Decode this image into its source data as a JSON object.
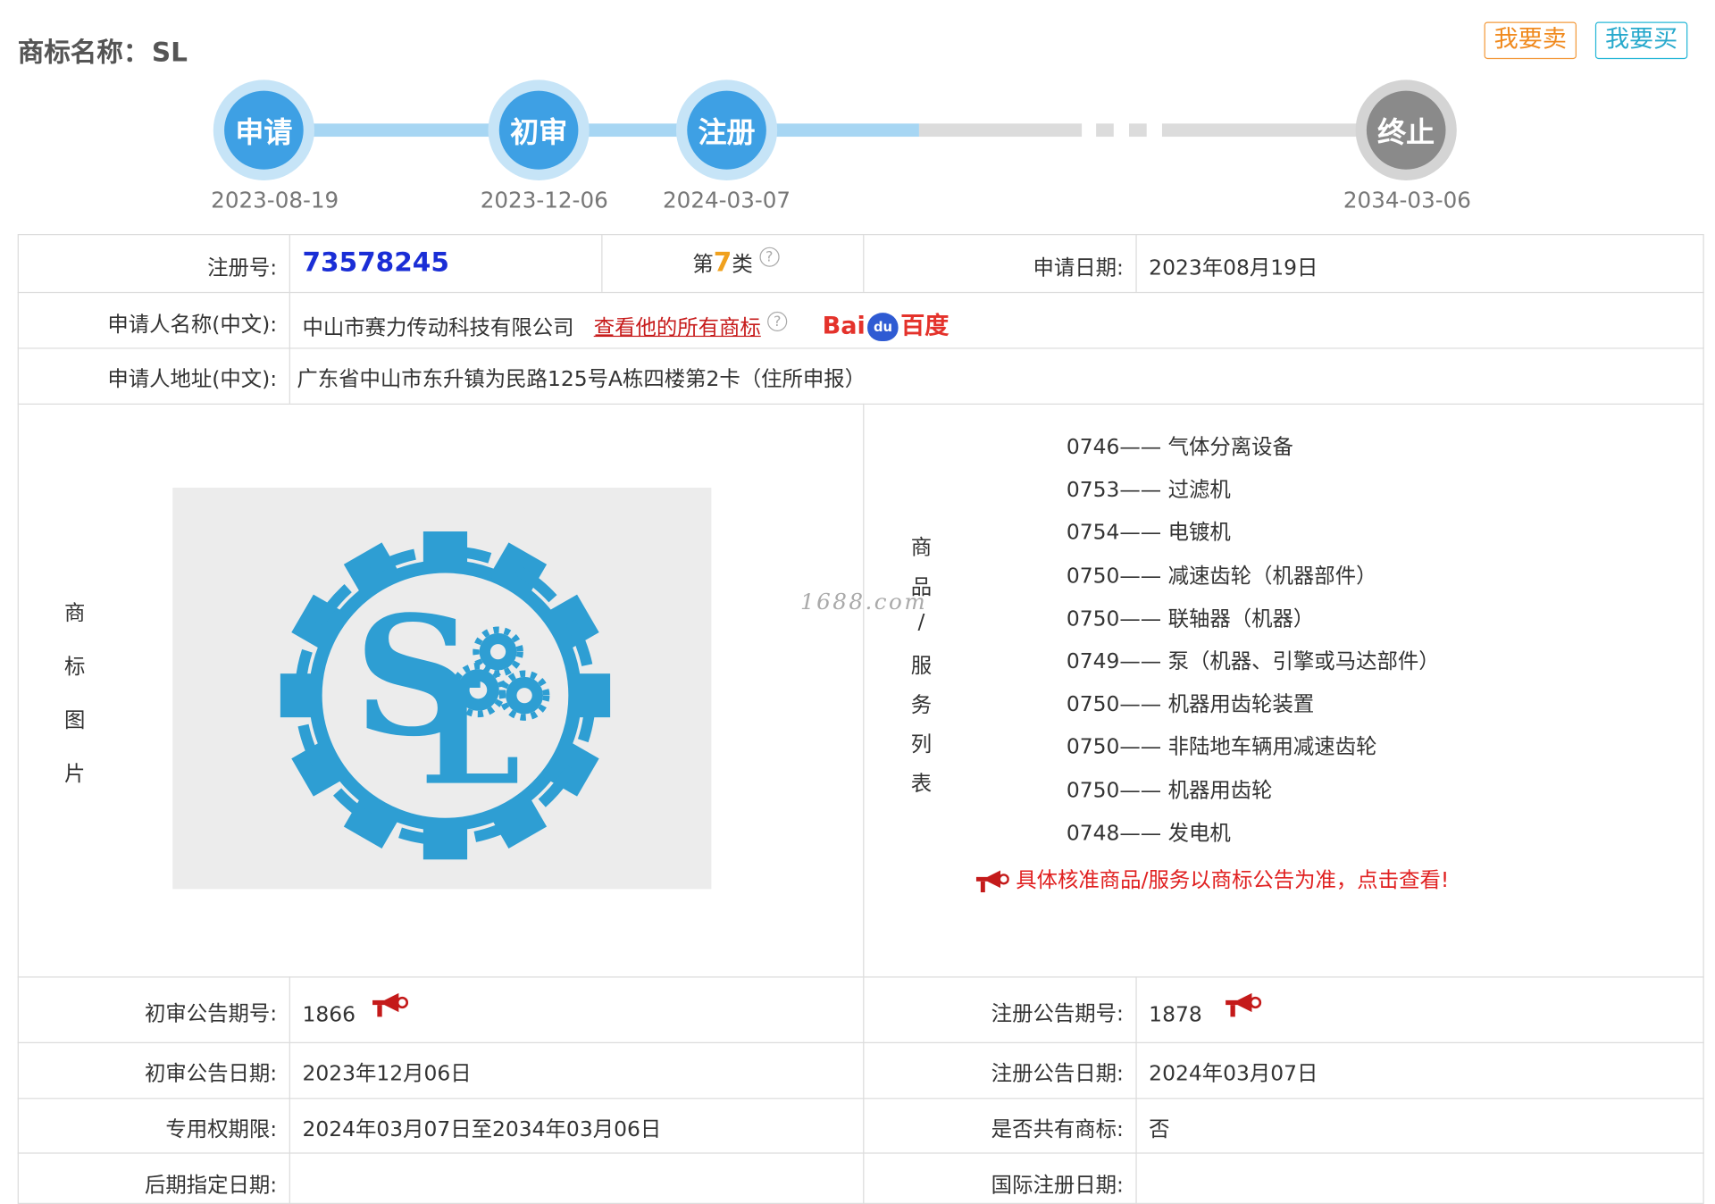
{
  "header": {
    "title_prefix": "商标名称：",
    "title_name": "SL",
    "sell_label": "我要卖",
    "buy_label": "我要买"
  },
  "timeline": {
    "steps": [
      {
        "label": "申请",
        "date": "2023-08-19",
        "state": "done"
      },
      {
        "label": "初审",
        "date": "2023-12-06",
        "state": "done"
      },
      {
        "label": "注册",
        "date": "2024-03-07",
        "state": "done"
      },
      {
        "label": "终止",
        "date": "2034-03-06",
        "state": "future"
      }
    ]
  },
  "info": {
    "reg_no_label": "注册号:",
    "reg_no": "73578245",
    "class_prefix": "第",
    "class_no": "7",
    "class_suffix": "类",
    "help_glyph": "?",
    "apply_date_label": "申请日期:",
    "apply_date": "2023年08月19日",
    "applicant_label": "申请人名称(中文):",
    "applicant": "中山市赛力传动科技有限公司",
    "all_marks_link": "查看他的所有商标",
    "baidu_left": "Bai",
    "baidu_paw": "du",
    "baidu_right": "百度",
    "address_label": "申请人地址(中文):",
    "address": "广东省中山市东升镇为民路125号A栋四楼第2卡（住所申报）",
    "image_label_chars": [
      "商",
      "标",
      "图",
      "片"
    ],
    "goods_label_chars": [
      "商",
      "品",
      "/",
      "服",
      "务",
      "列",
      "表"
    ],
    "logo_text": "SL",
    "watermark": "1688.com"
  },
  "goods": [
    {
      "code": "0746",
      "name": "气体分离设备"
    },
    {
      "code": "0753",
      "name": "过滤机"
    },
    {
      "code": "0754",
      "name": "电镀机"
    },
    {
      "code": "0750",
      "name": "减速齿轮（机器部件）"
    },
    {
      "code": "0750",
      "name": "联轴器（机器）"
    },
    {
      "code": "0749",
      "name": "泵（机器、引擎或马达部件）"
    },
    {
      "code": "0750",
      "name": "机器用齿轮装置"
    },
    {
      "code": "0750",
      "name": "非陆地车辆用减速齿轮"
    },
    {
      "code": "0750",
      "name": "机器用齿轮"
    },
    {
      "code": "0748",
      "name": "发电机"
    }
  ],
  "goods_notice": "具体核准商品/服务以商标公告为准，点击查看!",
  "bottom": {
    "prelim_no_label": "初审公告期号:",
    "prelim_no": "1866",
    "reg_pub_no_label": "注册公告期号:",
    "reg_pub_no": "1878",
    "prelim_date_label": "初审公告日期:",
    "prelim_date": "2023年12月06日",
    "reg_pub_date_label": "注册公告日期:",
    "reg_pub_date": "2024年03月07日",
    "exclusive_label": "专用权期限:",
    "exclusive": "2024年03月07日至2034年03月06日",
    "shared_label": "是否共有商标:",
    "shared": "否",
    "later_label": "后期指定日期:",
    "later": "",
    "intl_label": "国际注册日期:",
    "intl": ""
  },
  "colors": {
    "accent_blue": "#3ea0e4",
    "future_gray": "#8a8a8a",
    "reg_no": "#1a2ed6",
    "class": "#f0a11e",
    "link_red": "#c71c1c",
    "logo_blue": "#2e9ed3",
    "sell_orange": "#f08a1e",
    "buy_cyan": "#27a9cc"
  }
}
